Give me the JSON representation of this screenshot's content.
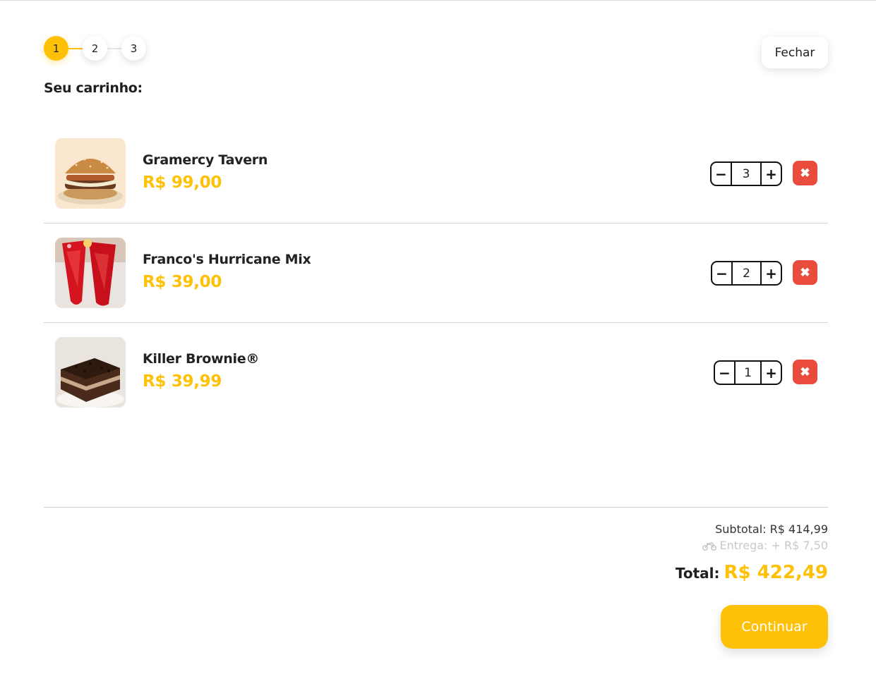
{
  "stepper": {
    "steps": [
      "1",
      "2",
      "3"
    ],
    "active_step": 1
  },
  "header": {
    "close_label": "Fechar",
    "cart_title": "Seu carrinho:"
  },
  "cart": {
    "items": [
      {
        "name": "Gramercy Tavern",
        "price": "R$ 99,00",
        "quantity": "3",
        "image": "burger"
      },
      {
        "name": "Franco's Hurricane Mix",
        "price": "R$ 39,00",
        "quantity": "2",
        "image": "red-drinks"
      },
      {
        "name": "Killer Brownie®",
        "price": "R$ 39,99",
        "quantity": "1",
        "image": "brownie"
      }
    ],
    "minus_symbol": "−",
    "plus_symbol": "+",
    "remove_symbol": "✖"
  },
  "summary": {
    "subtotal": "Subtotal: R$ 414,99",
    "delivery": "Entrega: + R$ 7,50",
    "delivery_icon": "motorcycle-icon",
    "total_label": "Total:",
    "total_value": "R$ 422,49"
  },
  "actions": {
    "continue_label": "Continuar"
  },
  "colors": {
    "accent": "#ffc107",
    "danger": "#e94b3c",
    "muted": "#c9c9c9"
  }
}
